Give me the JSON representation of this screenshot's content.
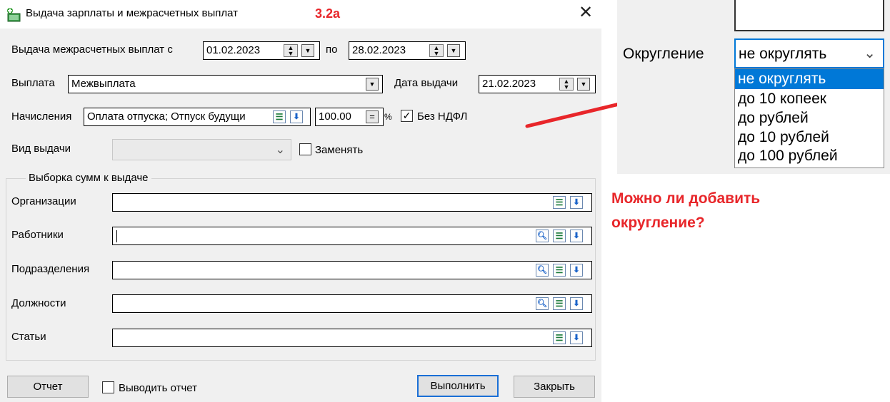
{
  "dialog": {
    "title": "Выдача зарплаты и межрасчетных выплат",
    "tag": "3.2а",
    "period_label": "Выдача межрасчетных выплат с",
    "date_from": "01.02.2023",
    "period_to_label": "по",
    "date_to": "28.02.2023",
    "payment_label": "Выплата",
    "payment_value": "Межвыплата",
    "issue_date_label": "Дата выдачи",
    "issue_date": "21.02.2023",
    "accruals_label": "Начисления",
    "accruals_value": "Оплата отпуска; Отпуск будущи",
    "percent_value": "100.00",
    "percent_sign": "%",
    "no_ndfl_label": "Без НДФЛ",
    "no_ndfl_checked": true,
    "issue_type_label": "Вид выдачи",
    "replace_label": "Заменять",
    "group_title": "Выборка сумм к выдаче",
    "filters": [
      {
        "label": "Организации"
      },
      {
        "label": "Работники"
      },
      {
        "label": "Подразделения"
      },
      {
        "label": "Должности"
      },
      {
        "label": "Статьи"
      }
    ],
    "report_button": "Отчет",
    "show_report_label": "Выводить отчет",
    "execute_button": "Выполнить",
    "close_button": "Закрыть"
  },
  "zoom": {
    "rounding_label": "Округление",
    "selected": "не округлять",
    "options": [
      "не округлять",
      "до 10 копеек",
      "до рублей",
      "до 10 рублей",
      "до 100 рублей"
    ]
  },
  "annotation": {
    "question_line1": "Можно ли добавить",
    "question_line2": "округление?"
  },
  "colors": {
    "accent_red": "#e8262a",
    "selection_blue": "#0078d7"
  }
}
